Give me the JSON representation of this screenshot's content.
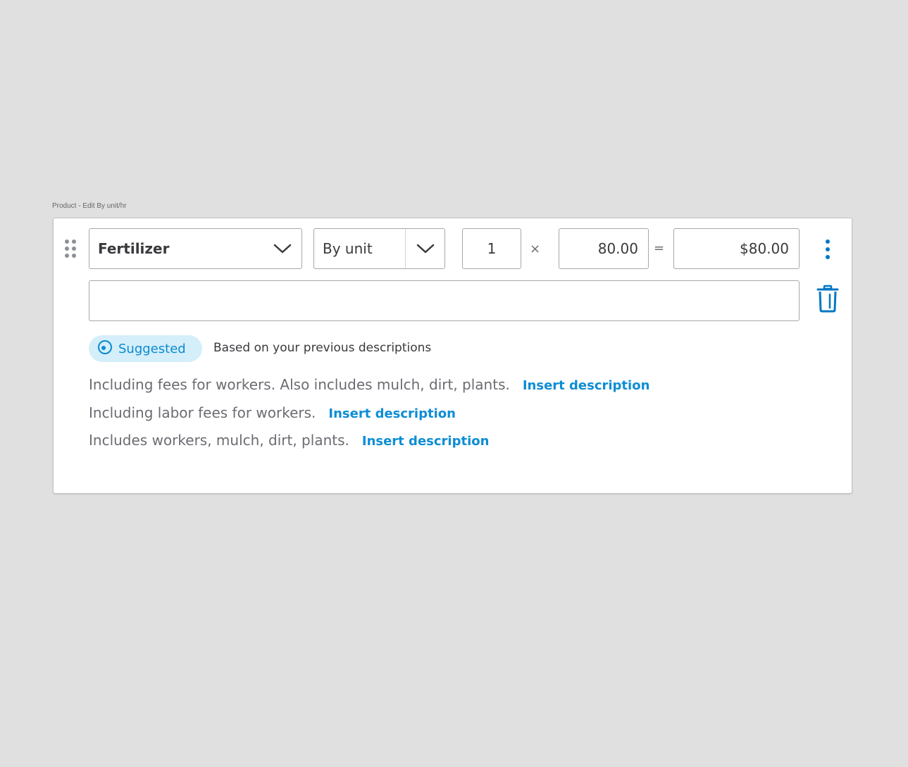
{
  "frame": {
    "label": "Product - Edit By unit/hr"
  },
  "line_item": {
    "product": "Fertilizer",
    "unit_type": "By unit",
    "quantity": "1",
    "rate": "80.00",
    "amount": "$80.00",
    "times_symbol": "×",
    "equals_symbol": "=",
    "description_value": ""
  },
  "suggestions": {
    "badge_label": "Suggested",
    "note": "Based on your previous descriptions",
    "items": [
      {
        "text": "Including fees for workers. Also includes mulch, dirt, plants.",
        "action": "Insert description"
      },
      {
        "text": "Including labor fees for workers.",
        "action": "Insert description"
      },
      {
        "text": "Includes workers, mulch, dirt, plants.",
        "action": "Insert description"
      }
    ]
  },
  "colors": {
    "accent": "#0d8dd4",
    "badge_bg": "#d4eefa",
    "icon_blue": "#0077c5"
  },
  "icons": {
    "drag": "drag-handle-icon",
    "dropdown": "chevron-down-icon",
    "more": "more-vertical-icon",
    "delete": "trash-icon",
    "suggested": "suggestion-icon"
  }
}
